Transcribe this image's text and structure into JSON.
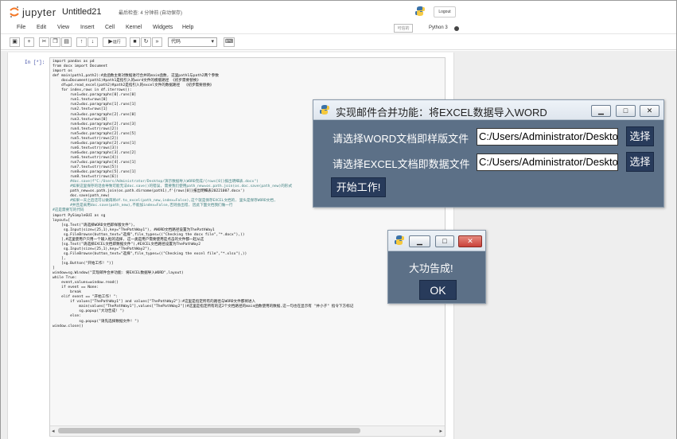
{
  "header": {
    "brand": "jupyter",
    "notebook_title": "Untitled21",
    "checkpoint": "最后检查: 4 分钟前 (自动保存)",
    "logout_label": "Logout"
  },
  "menubar": {
    "items": [
      "File",
      "Edit",
      "View",
      "Insert",
      "Cell",
      "Kernel",
      "Widgets",
      "Help"
    ],
    "trusted_label": "可信的",
    "kernel_label": "Python 3"
  },
  "toolbar": {
    "run_label": "运行",
    "cell_type": "代码"
  },
  "cell": {
    "prompt": "In  [*]:",
    "code_lines": [
      "import pandas as pd",
      "from docx import Document",
      "import os",
      "def main(path1,path2):#此函数主要对数据进行合并的main函数, 这里path1与path2两个参数",
      "    doc=Document(path1)#path1是指引入的word文件的模版路径 《初步需要替换》",
      "    df=pd.read_excel(path2)#path2是指引入的excel文件的数据路径  《初步需要替换》",
      "    for index,rows in df.iterrows():",
      "        run1=doc.paragraphs[0].runs[0]",
      "        run1.text=rows[0]",
      "        run2=doc.paragraphs[1].runs[1]",
      "        run2.text=rows[1]",
      "        run3=doc.paragraphs[2].runs[0]",
      "        run3.text=rows[0]",
      "        run4=doc.paragraphs[2].runs[3]",
      "        run4.text=str(rows[2])",
      "        run5=doc.paragraphs[2].runs[5]",
      "        run5.text=str(rows[2])",
      "        run6=doc.paragraphs[2].runs[1]",
      "        run6.text=str(rows[3])",
      "        run6=doc.paragraphs[3].runs[2]",
      "        run6.text=str(rows[4])",
      "        run7=doc.paragraphs[4].runs[1]",
      "        run7.text=str(rows[5])",
      "        run8=doc.paragraphs[5].runs[1]",
      "        run8.text=str(rows[6])",
      "        #doc.save(f\"C:/Users/Administrator/Desktop/演示数据导入WORD完成/{rows[0]}报出明细表.docx\")",
      "        #如果这里保存的话会导致可能无法doc.save()的错误, 需要我们使用path_new=os.path.join(os.doc.save(path_new)的形式",
      "        path_new=os.path.join(os.path.dirname(path1),f'{rows[0]}报出明细表20221007.docx')",
      "        doc.save(path_new)",
      "        #如果一天之后还可以做再将df.to_excel(path_new,index=False),这个就是保存EXCEL文档的, 里头是保存WORD文档,",
      "        #并且是采用doc.save(path_new),不能加index=False,否则会出错, 因此下面文档我们做一行",
      "#这是需要写的代码",
      "import PySimpleGUI as sg",
      "layout=[",
      "    [sg.Text(\"请选择WORD文档即样版文件\"),",
      "     sg.Input(size=(25,1),key=\"ThePathWay1\"), #WORD文档路径设置为ThePathWay1",
      "     sg.FileBrowse(button_text=\"选择\",file_types=((\"Checking the docx file\",\"*.docx\"),))",
      "    ],#这里使用户只用一个输入框的选择, 这一类是用户需要使用是点击的文件都一起从这",
      "    [sg.Text(\"请选择EXCEL文档即数据文件\"),#EXCEL文档路径设置为ThePathWay2",
      "     sg.Input(size=(25,1),key=\"ThePathWay2\"),",
      "     sg.FileBrowse(button_text=\"选择\",file_types=((\"Checking the excel file\",\"*.xlsx\"),))",
      "    ],",
      "    [sg.Button(\"开始工作! \")]",
      "]",
      "window=sg.Window(\"实现邮件合并功能: 将EXCEL数据导入WORD\",layout)",
      "while True:",
      "    event,values=window.read()",
      "    if event == None:",
      "        break",
      "    elif event == \"开始工作! \":",
      "        if values[\"ThePathWay1\"] and values[\"ThePathWay2\"]:#这里是指定所有的路径与WORD文件都将进入",
      "            main(values[\"ThePathWay1\"],values[\"ThePathWay2\"])#这里是指定所有的这2个文档路径的main函数使用的数据,这一句也在显示有 \"并小子\" 指令下方标记",
      "            sg.popup(\"大功告成! \")",
      "        else:",
      "            sg.popup(\"请先选择数据文件! \")",
      "window.close()"
    ]
  },
  "dialog": {
    "title": "实现邮件合并功能：将EXCEL数据导入WORD",
    "word_label": "请选择WORD文档即样版文件",
    "word_value": "C:/Users/Administrator/Deskto",
    "excel_label": "请选择EXCEL文档即数据文件",
    "excel_value": "C:/Users/Administrator/Deskto",
    "browse_label": "选择",
    "start_label": "开始工作!"
  },
  "popup": {
    "message": "大功告成!",
    "ok_label": "OK"
  },
  "colors": {
    "dialog_bg": "#5c7087",
    "button_bg": "#283b5b",
    "jupyter_orange": "#f37726",
    "close_red": "#c9423a"
  }
}
